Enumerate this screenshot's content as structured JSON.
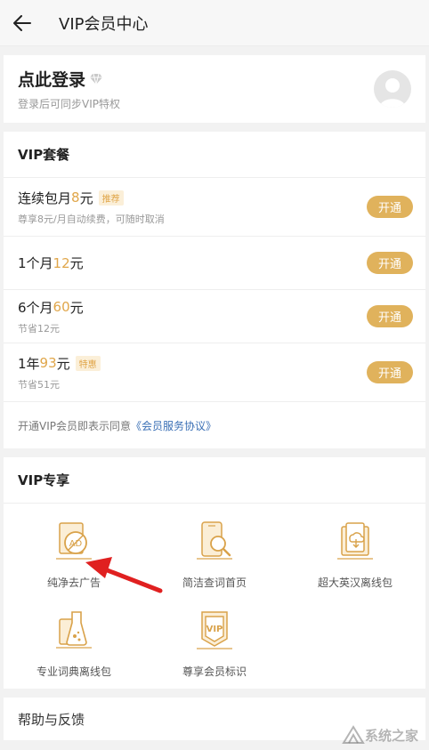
{
  "header": {
    "title": "VIP会员中心",
    "back_icon": "arrow-left-icon"
  },
  "login": {
    "title": "点此登录",
    "subtitle": "登录后可同步VIP特权",
    "badge_icon": "diamond-icon",
    "avatar_icon": "user-avatar-icon"
  },
  "packages": {
    "title": "VIP套餐",
    "items": [
      {
        "name_prefix": "连续包月",
        "price": "8",
        "unit": "元",
        "tag": "推荐",
        "desc": "尊享8元/月自动续费，可随时取消",
        "button": "开通"
      },
      {
        "name_prefix": "1个月",
        "price": "12",
        "unit": "元",
        "tag": "",
        "desc": "",
        "button": "开通"
      },
      {
        "name_prefix": "6个月",
        "price": "60",
        "unit": "元",
        "tag": "",
        "desc": "节省12元",
        "button": "开通"
      },
      {
        "name_prefix": "1年",
        "price": "93",
        "unit": "元",
        "tag": "特惠",
        "desc": "节省51元",
        "button": "开通"
      }
    ],
    "agreement_text": "开通VIP会员即表示同意",
    "agreement_link": "《会员服务协议》"
  },
  "privileges": {
    "title": "VIP专享",
    "items": [
      {
        "label": "纯净去广告",
        "icon": "no-ads-icon"
      },
      {
        "label": "简洁查词首页",
        "icon": "phone-search-icon"
      },
      {
        "label": "超大英汉离线包",
        "icon": "cloud-download-icon"
      },
      {
        "label": "专业词典离线包",
        "icon": "flask-icon"
      },
      {
        "label": "尊享会员标识",
        "icon": "vip-badge-icon"
      }
    ]
  },
  "help": {
    "label": "帮助与反馈"
  },
  "watermark": {
    "text": "系统之家"
  },
  "colors": {
    "accent": "#e0b25c",
    "price": "#e0a64a",
    "link": "#3a6fb5",
    "annotation_arrow": "#e02020"
  }
}
